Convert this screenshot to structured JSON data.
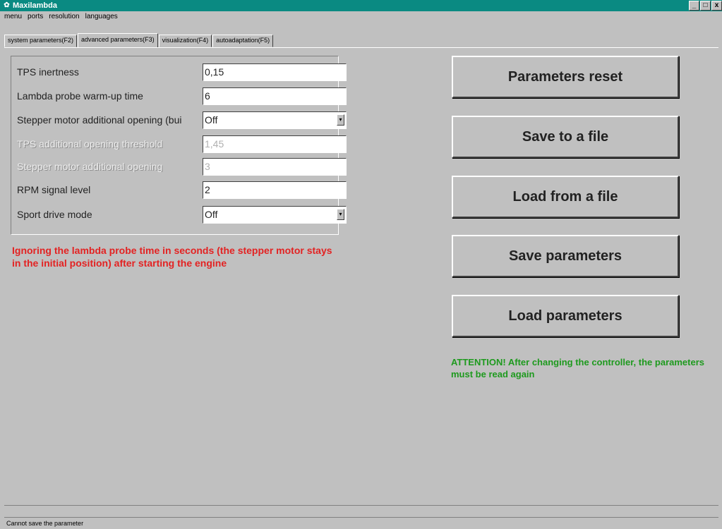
{
  "window": {
    "title": "Maxilambda",
    "controls": [
      "_",
      "□",
      "x"
    ]
  },
  "menu": [
    "menu",
    "ports",
    "resolution",
    "languages"
  ],
  "tabs": [
    {
      "label": "system parameters(F2)",
      "active": false
    },
    {
      "label": "advanced parameters(F3)",
      "active": true
    },
    {
      "label": "visualization(F4)",
      "active": false
    },
    {
      "label": "autoadaptation(F5)",
      "active": false
    }
  ],
  "params": [
    {
      "label": "TPS inertness",
      "value": "0,15",
      "enabled": true,
      "type": "text"
    },
    {
      "label": "Lambda probe warm-up time",
      "value": "6",
      "enabled": true,
      "type": "text"
    },
    {
      "label": "Stepper motor additional opening (bui",
      "value": "Off",
      "enabled": true,
      "type": "select"
    },
    {
      "label": "TPS additional opening threshold",
      "value": "1,45",
      "enabled": false,
      "type": "text"
    },
    {
      "label": "Stepper motor additional opening",
      "value": "3",
      "enabled": false,
      "type": "text"
    },
    {
      "label": "RPM signal level",
      "value": "2",
      "enabled": true,
      "type": "text"
    },
    {
      "label": "Sport drive mode",
      "value": "Off",
      "enabled": true,
      "type": "select"
    }
  ],
  "hint": "Ignoring the lambda probe time in seconds (the stepper motor stays in the initial position) after starting the engine",
  "buttons": {
    "reset": "Parameters reset",
    "save_file": "Save to a file",
    "load_file": "Load from a file",
    "save_params": "Save parameters",
    "load_params": "Load parameters"
  },
  "attention": "ATTENTION! After changing the controller, the parameters must be read again",
  "status": "Cannot save the parameter",
  "colors": {
    "titlebar": "#0a8a82",
    "hint": "#e32222",
    "attention": "#1e9a1e"
  }
}
